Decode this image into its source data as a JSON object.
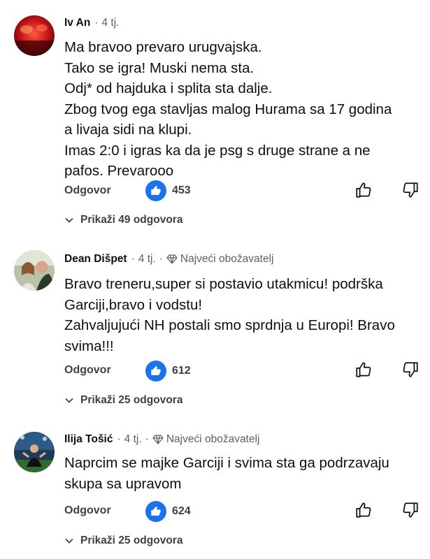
{
  "comments": [
    {
      "author": "Iv An",
      "time": "4 tj.",
      "badge": "",
      "text_lines": [
        "Ma bravoo prevaro urugvajska.",
        "Tako se igra! Muski nema sta.",
        "Odj* od hajduka i splita sta dalje.",
        "Zbog tvog ega stavljas malog Hurama sa 17 godina",
        "a livaja sidi na klupi.",
        "Imas 2:0 i igras ka da je psg s druge strane a ne",
        "pafos. Prevarooo"
      ],
      "reply_label": "Odgovor",
      "likes": "453",
      "replies_label": "Prikaži 49 odgovora"
    },
    {
      "author": "Dean Dišpet",
      "time": "4 tj.",
      "badge": "Najveći obožavatelj",
      "text_lines": [
        "Bravo treneru,super si postavio utakmicu! podrška",
        "Garciji,bravo i vodstu!",
        "Zahvaljujući NH postali smo sprdnja u Europi! Bravo",
        "svima!!!"
      ],
      "reply_label": "Odgovor",
      "likes": "612",
      "replies_label": "Prikaži 25 odgovora"
    },
    {
      "author": "Ilija Tošić",
      "time": "4 tj.",
      "badge": "Najveći obožavatelj",
      "text_lines": [
        "Naprcim se majke Garciji i svima sta ga podrzavaju",
        "skupa sa upravom"
      ],
      "reply_label": "Odgovor",
      "likes": "624",
      "replies_label": "Prikaži 25 odgovora"
    }
  ],
  "separator": "·",
  "icons": {
    "like_badge": "thumbs-up-filled-icon",
    "like": "thumbs-up-outline-icon",
    "dislike": "thumbs-down-outline-icon",
    "badge": "diamond-icon",
    "expand": "chevron-down-icon"
  },
  "colors": {
    "like_badge": "#1a73e8",
    "meta_text": "#606060",
    "body_text": "#0f0f0f"
  }
}
